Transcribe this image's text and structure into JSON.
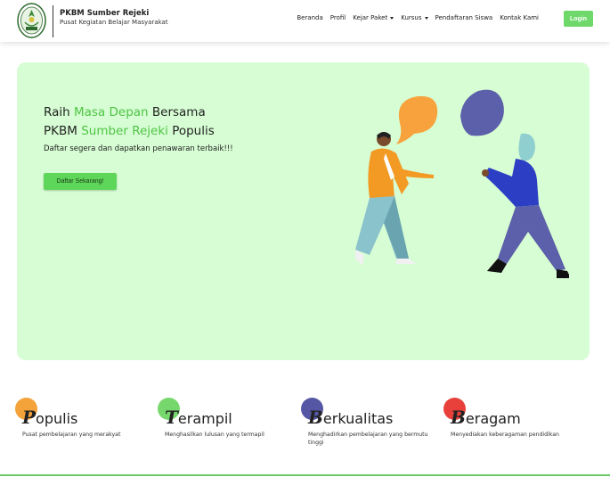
{
  "brand": {
    "name": "PKBM Sumber Rejeki",
    "tagline": "Pusat Kegiatan Belajar Masyarakat",
    "logo_icon": "school-emblem-icon"
  },
  "nav": {
    "items": [
      {
        "label": "Beranda"
      },
      {
        "label": "Profil"
      },
      {
        "label": "Kejar Paket"
      },
      {
        "label": "Kursus"
      },
      {
        "label": "Pendaftaran Siswa"
      },
      {
        "label": "Kontak Kami"
      }
    ],
    "login": "Login"
  },
  "hero": {
    "line1": {
      "before": "Raih ",
      "accent": "Masa Depan",
      "after": " Bersama"
    },
    "line2": {
      "before": "PKBM ",
      "accent": "Sumber Rejeki",
      "after": " Populis"
    },
    "subtitle": "Daftar segera dan dapatkan penawaran terbaik!!!",
    "cta": "Daftar Sekarang!"
  },
  "features": [
    {
      "first": "P",
      "rest": "opulis",
      "desc": "Pusat pembelajaran yang merakyat",
      "color": "#f4a23a"
    },
    {
      "first": "T",
      "rest": "erampil",
      "desc": "Menghasilkan lulusan yang termapil",
      "color": "#76d86c"
    },
    {
      "first": "B",
      "rest": "erkualitas",
      "desc": "Menghadirkan pembelajaran yang bermutu tinggi",
      "color": "#5557a5"
    },
    {
      "first": "B",
      "rest": "eragam",
      "desc": "Menyediakan keberagaman pendidikan",
      "color": "#e8403a"
    }
  ],
  "colors": {
    "accent": "#4fc444",
    "hero_bg": "#d6fdd3",
    "button": "#6fd86a"
  }
}
